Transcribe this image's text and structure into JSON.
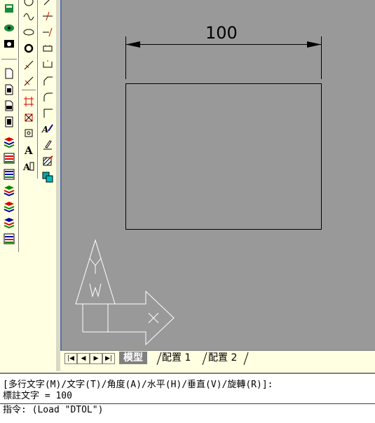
{
  "drawing": {
    "dimension_text": "100"
  },
  "tabs": {
    "model": "模型",
    "layout1": "配置 1",
    "layout2": "配置 2"
  },
  "command": {
    "line1": "[多行文字(M)/文字(T)/角度(A)/水平(H)/垂直(V)/旋轉(R)]:",
    "line2": "標註文字 = 100",
    "line3": "指令: (Load \"DTOL\")"
  },
  "toolbars": {
    "left": [
      "layers-icon",
      "properties-icon",
      "display-icon",
      "new-icon",
      "open-icon",
      "save-icon",
      "print-icon",
      "layer-icon-1",
      "layer-icon-2",
      "layer-icon-3",
      "layer-icon-4",
      "layer-icon-5",
      "layer-icon-6",
      "layer-icon-7"
    ],
    "middle": [
      "circle-icon",
      "arc-icon",
      "ellipse-icon",
      "donut-icon",
      "polyline-icon",
      "spline-icon",
      "region-icon",
      "hatch-icon",
      "point-icon",
      "text-icon",
      "mtext-icon"
    ],
    "right": [
      "line-icon",
      "trim-icon",
      "extend-icon",
      "rectangle-icon",
      "break-icon",
      "fillet-icon",
      "chamfer-icon",
      "corner-icon",
      "spell-icon",
      "edit-icon",
      "hatch-edit-icon",
      "color-icon"
    ]
  }
}
